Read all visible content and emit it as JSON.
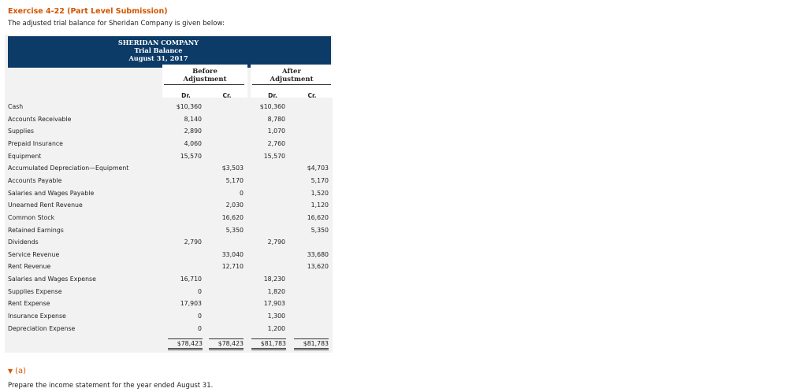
{
  "exercise": {
    "title": "Exercise 4-22 (Part Level Submission)",
    "intro": "The adjusted trial balance for Sheridan Company is given below:"
  },
  "statement": {
    "company": "SHERIDAN COMPANY",
    "name": "Trial Balance",
    "date": "August 31, 2017"
  },
  "columns": {
    "before_line1": "Before",
    "before_line2": "Adjustment",
    "after_line1": "After",
    "after_line2": "Adjustment",
    "dr": "Dr.",
    "cr": "Cr."
  },
  "rows": [
    {
      "account": "Cash",
      "before_dr": "$10,360",
      "before_cr": "",
      "after_dr": "$10,360",
      "after_cr": ""
    },
    {
      "account": "Accounts Receivable",
      "before_dr": "8,140",
      "before_cr": "",
      "after_dr": "8,780",
      "after_cr": ""
    },
    {
      "account": "Supplies",
      "before_dr": "2,890",
      "before_cr": "",
      "after_dr": "1,070",
      "after_cr": ""
    },
    {
      "account": "Prepaid Insurance",
      "before_dr": "4,060",
      "before_cr": "",
      "after_dr": "2,760",
      "after_cr": ""
    },
    {
      "account": "Equipment",
      "before_dr": "15,570",
      "before_cr": "",
      "after_dr": "15,570",
      "after_cr": ""
    },
    {
      "account": "Accumulated Depreciation—Equipment",
      "before_dr": "",
      "before_cr": "$3,503",
      "after_dr": "",
      "after_cr": "$4,703"
    },
    {
      "account": "Accounts Payable",
      "before_dr": "",
      "before_cr": "5,170",
      "after_dr": "",
      "after_cr": "5,170"
    },
    {
      "account": "Salaries and Wages Payable",
      "before_dr": "",
      "before_cr": "0",
      "after_dr": "",
      "after_cr": "1,520"
    },
    {
      "account": "Unearned Rent Revenue",
      "before_dr": "",
      "before_cr": "2,030",
      "after_dr": "",
      "after_cr": "1,120"
    },
    {
      "account": "Common Stock",
      "before_dr": "",
      "before_cr": "16,620",
      "after_dr": "",
      "after_cr": "16,620"
    },
    {
      "account": "Retained Earnings",
      "before_dr": "",
      "before_cr": "5,350",
      "after_dr": "",
      "after_cr": "5,350"
    },
    {
      "account": "Dividends",
      "before_dr": "2,790",
      "before_cr": "",
      "after_dr": "2,790",
      "after_cr": ""
    },
    {
      "account": "Service Revenue",
      "before_dr": "",
      "before_cr": "33,040",
      "after_dr": "",
      "after_cr": "33,680"
    },
    {
      "account": "Rent Revenue",
      "before_dr": "",
      "before_cr": "12,710",
      "after_dr": "",
      "after_cr": "13,620"
    },
    {
      "account": "Salaries and Wages Expense",
      "before_dr": "16,710",
      "before_cr": "",
      "after_dr": "18,230",
      "after_cr": ""
    },
    {
      "account": "Supplies Expense",
      "before_dr": "0",
      "before_cr": "",
      "after_dr": "1,820",
      "after_cr": ""
    },
    {
      "account": "Rent Expense",
      "before_dr": "17,903",
      "before_cr": "",
      "after_dr": "17,903",
      "after_cr": ""
    },
    {
      "account": "Insurance Expense",
      "before_dr": "0",
      "before_cr": "",
      "after_dr": "1,300",
      "after_cr": ""
    },
    {
      "account": "Depreciation Expense",
      "before_dr": "0",
      "before_cr": "",
      "after_dr": "1,200",
      "after_cr": ""
    }
  ],
  "totals": {
    "before_dr": "$78,423",
    "before_cr": "$78,423",
    "after_dr": "$81,783",
    "after_cr": "$81,783"
  },
  "part": {
    "label": "(a)",
    "prompt": "Prepare the income statement for the year ended August 31."
  },
  "colors": {
    "accent": "#d35400",
    "header_bg": "#0c3b68"
  }
}
